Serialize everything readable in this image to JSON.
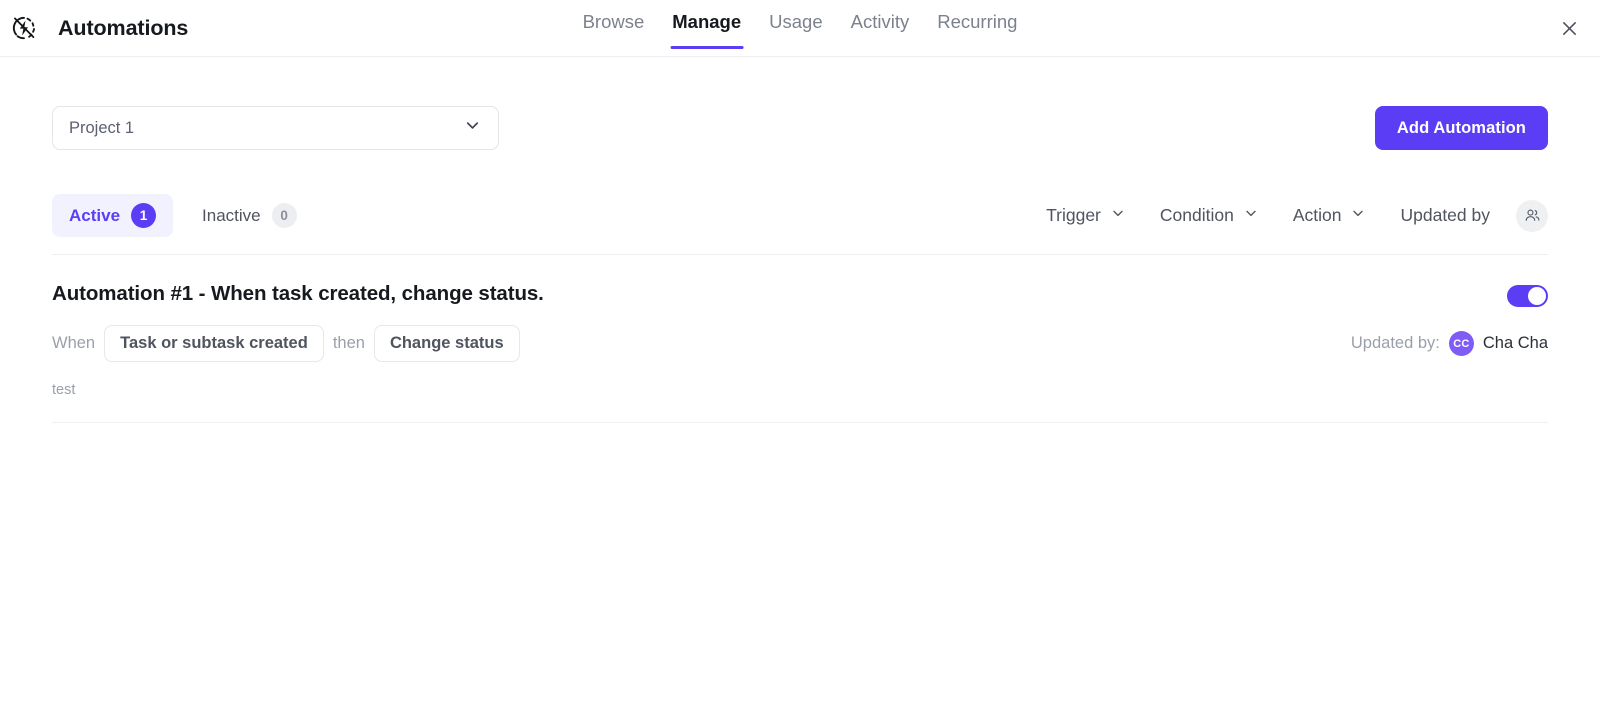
{
  "header": {
    "logo_icon": "automation-bolt-icon",
    "title": "Automations",
    "close_icon": "close-icon",
    "nav": [
      {
        "label": "Browse",
        "active": false
      },
      {
        "label": "Manage",
        "active": true
      },
      {
        "label": "Usage",
        "active": false
      },
      {
        "label": "Activity",
        "active": false
      },
      {
        "label": "Recurring",
        "active": false
      }
    ]
  },
  "toolbar": {
    "project_select": {
      "value": "Project 1",
      "chevron_icon": "chevron-down-icon"
    },
    "add_button_label": "Add Automation"
  },
  "filterbar": {
    "status_tabs": [
      {
        "label": "Active",
        "count": "1",
        "selected": true
      },
      {
        "label": "Inactive",
        "count": "0",
        "selected": false
      }
    ],
    "filters": [
      {
        "label": "Trigger",
        "icon": "chevron-down-icon"
      },
      {
        "label": "Condition",
        "icon": "chevron-down-icon"
      },
      {
        "label": "Action",
        "icon": "chevron-down-icon"
      }
    ],
    "updated_by_label": "Updated by",
    "updated_by_avatar_icon": "people-icon"
  },
  "automations": [
    {
      "title": "Automation #1 - When task created, change status.",
      "enabled": true,
      "when_label": "When",
      "trigger_chip": "Task or subtask created",
      "then_label": "then",
      "action_chip": "Change status",
      "updated_by_prefix": "Updated by:",
      "updated_by_initials": "CC",
      "updated_by_name": "Cha Cha",
      "description": "test"
    }
  ],
  "colors": {
    "accent": "#5b3df5",
    "accent_soft": "#f2f1fe",
    "avatar": "#7f5cf5",
    "text_primary": "#16191d",
    "text_muted": "#9aa0ab",
    "border": "#eceef1"
  }
}
